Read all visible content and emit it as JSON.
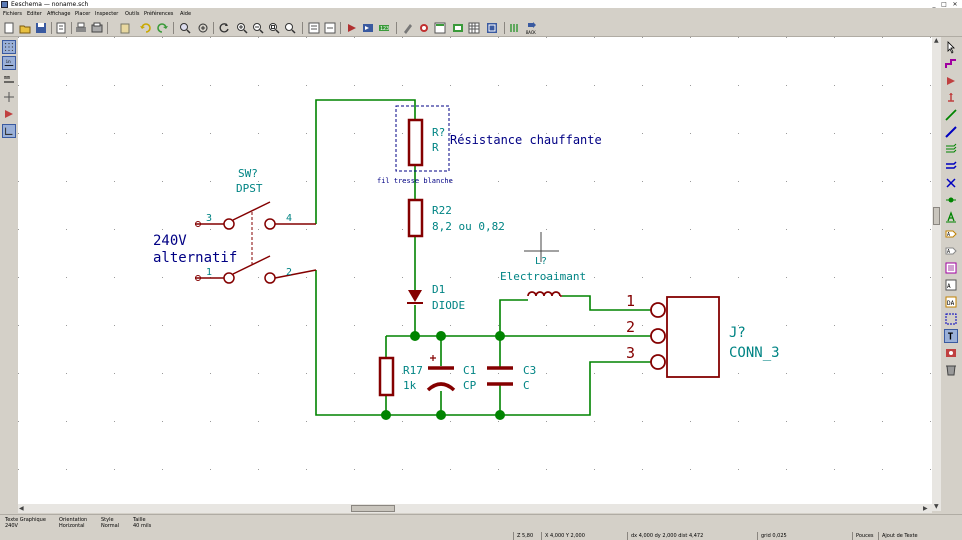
{
  "window": {
    "title": "Eeschema — noname.sch"
  },
  "menu": [
    "Fichiers",
    "Editer",
    "Affichage",
    "Placer",
    "Inspecter",
    "Outils",
    "Préférences",
    "Aide"
  ],
  "left_toolbar": {
    "units_in": "in",
    "units_mm": "mm"
  },
  "toolbar": {
    "back_label": "BACK"
  },
  "schematic": {
    "heater_ref": "R?",
    "heater_value": "R",
    "heater_desc": "Résistance chauffante",
    "heater_note": "fil tresse blanche",
    "r22_ref": "R22",
    "r22_value": "8,2 ou 0,82",
    "d1_ref": "D1",
    "d1_value": "DIODE",
    "sw_ref": "SW?",
    "sw_value": "DPST",
    "sw_pin3": "3",
    "sw_pin4": "4",
    "sw_pin1": "1",
    "sw_pin2": "2",
    "supply_line1": "240V",
    "supply_line2": "alternatif",
    "coil_ref": "L?",
    "coil_value": "Electroaimant",
    "r17_ref": "R17",
    "r17_value": "1k",
    "c1_ref": "C1",
    "c1_value": "CP",
    "c3_ref": "C3",
    "c3_value": "C",
    "conn_ref": "J?",
    "conn_value": "CONN_3",
    "conn_pin1": "1",
    "conn_pin2": "2",
    "conn_pin3": "3"
  },
  "status": {
    "msg1_title": "Texte Graphique",
    "msg1_value": "240V",
    "msg2_title": "Orientation",
    "msg2_value": "Horizontal",
    "msg3_title": "Style",
    "msg3_value": "Normal",
    "msg4_title": "Taille",
    "msg4_value": "40 mils",
    "zoom": "Z 5,80",
    "xy": "X 4,000  Y 2,000",
    "dxy": "dx 4,000  dy 2,000  dist 4,472",
    "grid": "grid 0,025",
    "units": "Pouces",
    "action": "Ajout de Texte"
  }
}
